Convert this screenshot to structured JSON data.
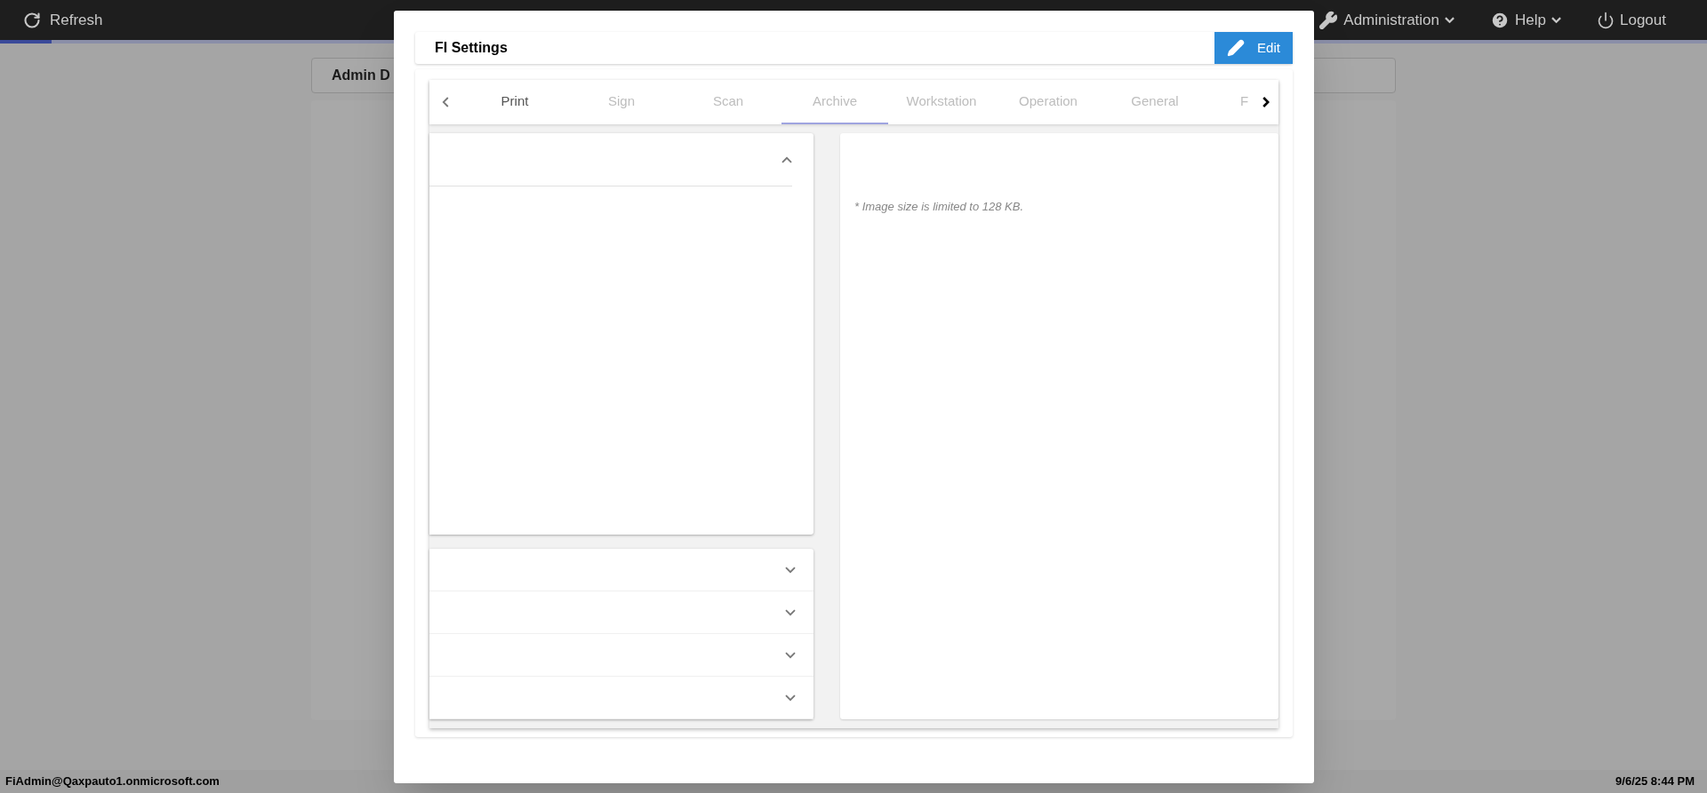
{
  "top_bar": {
    "refresh": "Refresh",
    "menus": [
      {
        "kind": "wrench",
        "label": "Administration",
        "dropdown": true
      },
      {
        "kind": "help",
        "label": "Help",
        "dropdown": true
      },
      {
        "kind": "power",
        "label": "Logout",
        "dropdown": false
      }
    ],
    "progress": {
      "level": 0.03
    }
  },
  "background": {
    "card_title": "Admin D"
  },
  "dialog": {
    "title": "FI Settings",
    "edit_button": "Edit",
    "tabs": [
      {
        "label": "Print",
        "selected": false,
        "dimmed": false
      },
      {
        "label": "Sign",
        "selected": false,
        "dimmed": true
      },
      {
        "label": "Scan",
        "selected": false,
        "dimmed": true
      },
      {
        "label": "Archive",
        "selected": true,
        "dimmed": true
      },
      {
        "label": "Workstation",
        "selected": false,
        "dimmed": true
      },
      {
        "label": "Operation",
        "selected": false,
        "dimmed": true
      },
      {
        "label": "General",
        "selected": false,
        "dimmed": true
      },
      {
        "label": "F",
        "selected": false,
        "dimmed": true
      }
    ],
    "panels": [
      {
        "expanded": true
      },
      {
        "expanded": false
      },
      {
        "expanded": false
      },
      {
        "expanded": false
      },
      {
        "expanded": false
      }
    ],
    "note": "* Image size is limited to 128 KB."
  },
  "status_bar": {
    "user": "FiAdmin@Qaxpauto1.onmicrosoft.com",
    "datetime": "9/6/25 8:44 PM"
  }
}
